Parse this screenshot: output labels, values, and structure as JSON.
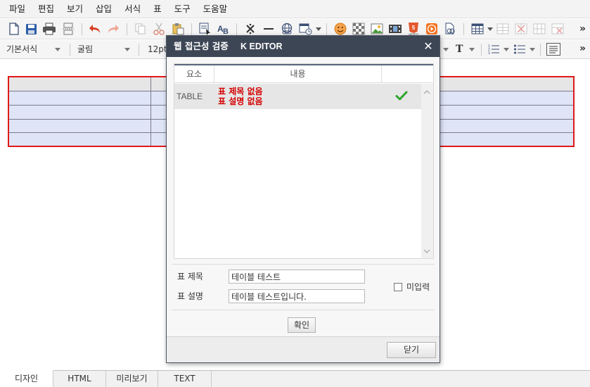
{
  "menu": [
    "파일",
    "편집",
    "보기",
    "삽입",
    "서식",
    "표",
    "도구",
    "도움말"
  ],
  "toolbar2": {
    "paragraph_style": "기본서식",
    "font": "굴림",
    "font_size": "12pt",
    "text_color_glyph": "T"
  },
  "overflow_glyph": "»",
  "bottom_tabs": [
    "디자인",
    "HTML",
    "미리보기",
    "TEXT"
  ],
  "active_tab": "디자인",
  "dialog": {
    "title": "웹 접근성 검증",
    "brand": "K EDITOR",
    "close_glyph": "✕",
    "columns": [
      "요소",
      "내용",
      ""
    ],
    "results": [
      {
        "element": "TABLE",
        "messages": [
          "표 제목 없음",
          "표 설명 없음"
        ],
        "status": "check",
        "status_color": "#2ea52e"
      }
    ],
    "caption_label": "표 제목",
    "caption_value": "테이블 테스트",
    "summary_label": "표 설명",
    "summary_value": "테이블 테스트입니다.",
    "no_input_label": "미입력",
    "no_input_checked": false,
    "confirm_label": "확인",
    "close_label": "닫기"
  },
  "colors": {
    "error_red": "#d40000",
    "table_border": "#e01919",
    "dialog_title_bg": "#3d4655"
  }
}
